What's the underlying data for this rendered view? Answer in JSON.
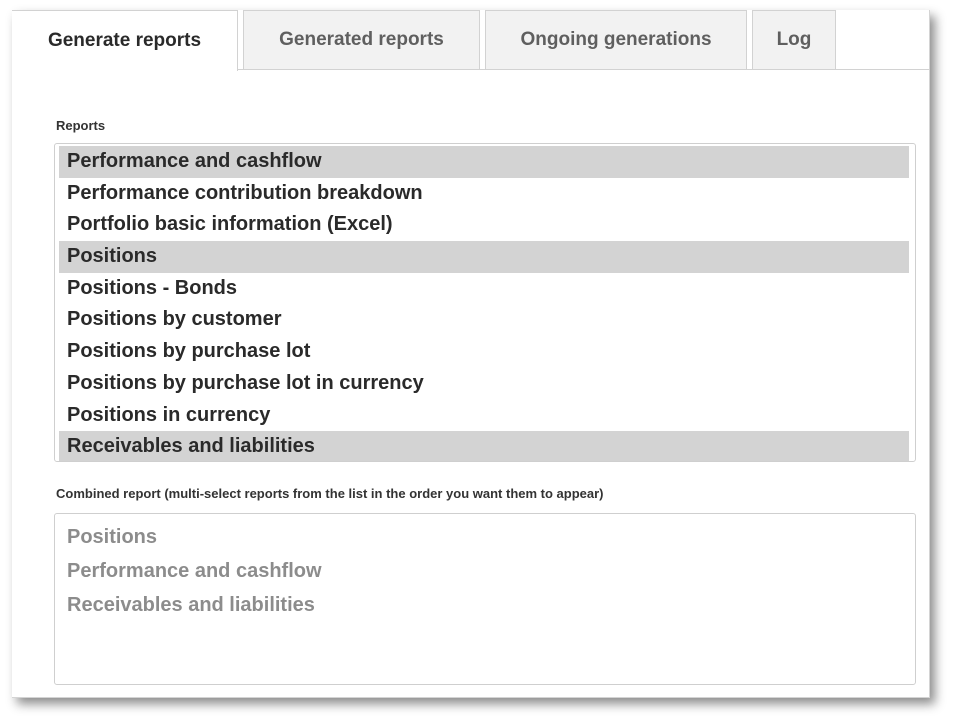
{
  "tabs": [
    {
      "label": "Generate reports",
      "active": true
    },
    {
      "label": "Generated reports",
      "active": false
    },
    {
      "label": "Ongoing generations",
      "active": false
    },
    {
      "label": "Log",
      "active": false
    }
  ],
  "reports_section": {
    "label": "Reports",
    "items": [
      {
        "label": "Performance and cashflow",
        "selected": true
      },
      {
        "label": "Performance contribution breakdown",
        "selected": false
      },
      {
        "label": "Portfolio basic information (Excel)",
        "selected": false
      },
      {
        "label": "Positions",
        "selected": true
      },
      {
        "label": "Positions - Bonds",
        "selected": false
      },
      {
        "label": "Positions by customer",
        "selected": false
      },
      {
        "label": "Positions by purchase lot",
        "selected": false
      },
      {
        "label": "Positions by purchase lot in currency",
        "selected": false
      },
      {
        "label": "Positions in currency",
        "selected": false
      },
      {
        "label": "Receivables and liabilities",
        "selected": true
      }
    ]
  },
  "combined_section": {
    "label": "Combined report (multi-select reports from the list in the order you want them to appear)",
    "items": [
      "Positions",
      "Performance and cashflow",
      "Receivables and liabilities"
    ]
  },
  "colors": {
    "selected_row": "#d3d3d3",
    "tab_inactive_bg": "#f2f2f2",
    "combined_text": "#8c8c8c"
  }
}
